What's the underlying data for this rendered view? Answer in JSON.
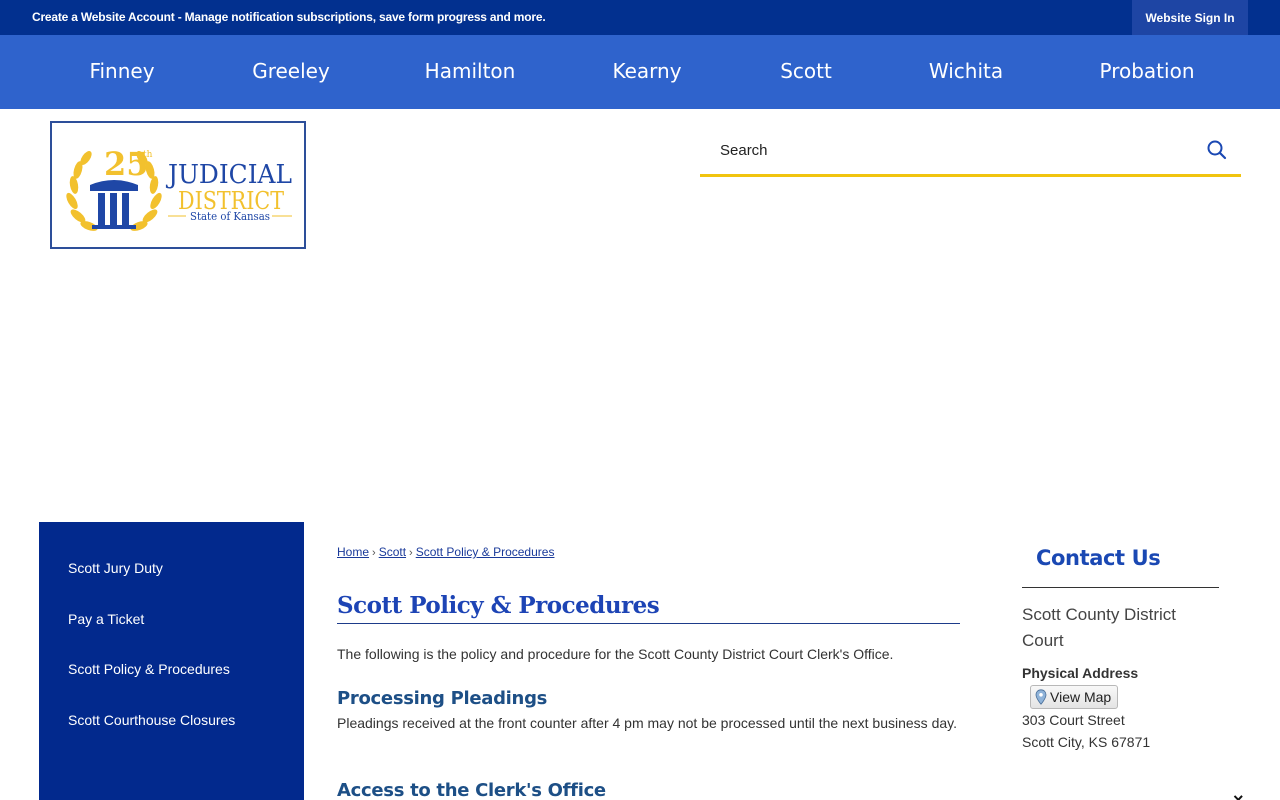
{
  "topbar": {
    "message": "Create a Website Account - Manage notification subscriptions, save form progress and more.",
    "signin_label": "Website Sign In"
  },
  "nav": {
    "items": [
      "Finney",
      "Greeley",
      "Hamilton",
      "Kearny",
      "Scott",
      "Wichita",
      "Probation"
    ]
  },
  "logo": {
    "number": "25",
    "suffix": "th",
    "line1": "JUDICIAL",
    "line2": "DISTRICT",
    "line3": "State of Kansas"
  },
  "search": {
    "placeholder": "Search",
    "icon": "search-icon"
  },
  "sidebar": {
    "items": [
      {
        "label": "Scott Jury Duty"
      },
      {
        "label": "Pay a Ticket"
      },
      {
        "label": "Scott Policy & Procedures"
      },
      {
        "label": "Scott Courthouse Closures"
      }
    ]
  },
  "breadcrumb": {
    "items": [
      "Home",
      "Scott",
      "Scott Policy & Procedures"
    ],
    "separator": "›"
  },
  "content": {
    "title": "Scott Policy & Procedures",
    "intro": "The following is the policy and procedure for the Scott County District Court Clerk's Office.",
    "sections": [
      {
        "heading": "Processing Pleadings",
        "body": "Pleadings received at the front counter after 4 pm may not be processed until the next business day."
      },
      {
        "heading": "Access to the Clerk's Office",
        "body": ""
      }
    ]
  },
  "contact": {
    "title": "Contact Us",
    "org": "Scott County District Court",
    "address_label": "Physical Address",
    "map_label": "View Map",
    "street": "303 Court Street",
    "city": "Scott City, KS 67871"
  },
  "colors": {
    "topbar": "#02308f",
    "nav": "#2f63cc",
    "sidebar": "#02298d",
    "accent_gold": "#f1c40f",
    "title_blue": "#1d44b5"
  },
  "close_label": "×"
}
